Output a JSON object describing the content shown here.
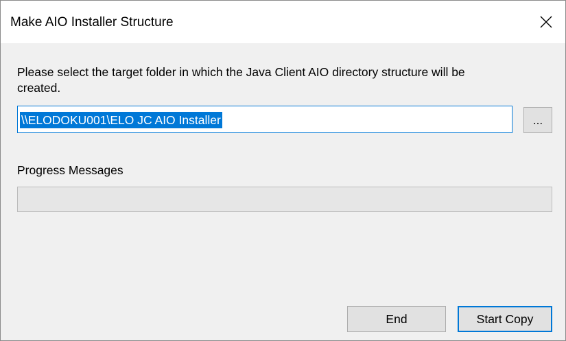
{
  "window": {
    "title": "Make AIO Installer Structure",
    "close_icon": "close-icon"
  },
  "main": {
    "instruction": "Please select the target folder in which the Java Client AIO directory structure will be created.",
    "target_folder": {
      "value": "\\\\ELODOKU001\\ELO JC AIO Installer",
      "selected": true
    },
    "browse_label": "...",
    "progress_label": "Progress Messages",
    "progress_fraction": 0
  },
  "buttons": {
    "end_label": "End",
    "start_copy_label": "Start Copy"
  },
  "colors": {
    "accent": "#0078d7",
    "button_face": "#e1e1e1",
    "dialog_background": "#f0f0f0"
  }
}
